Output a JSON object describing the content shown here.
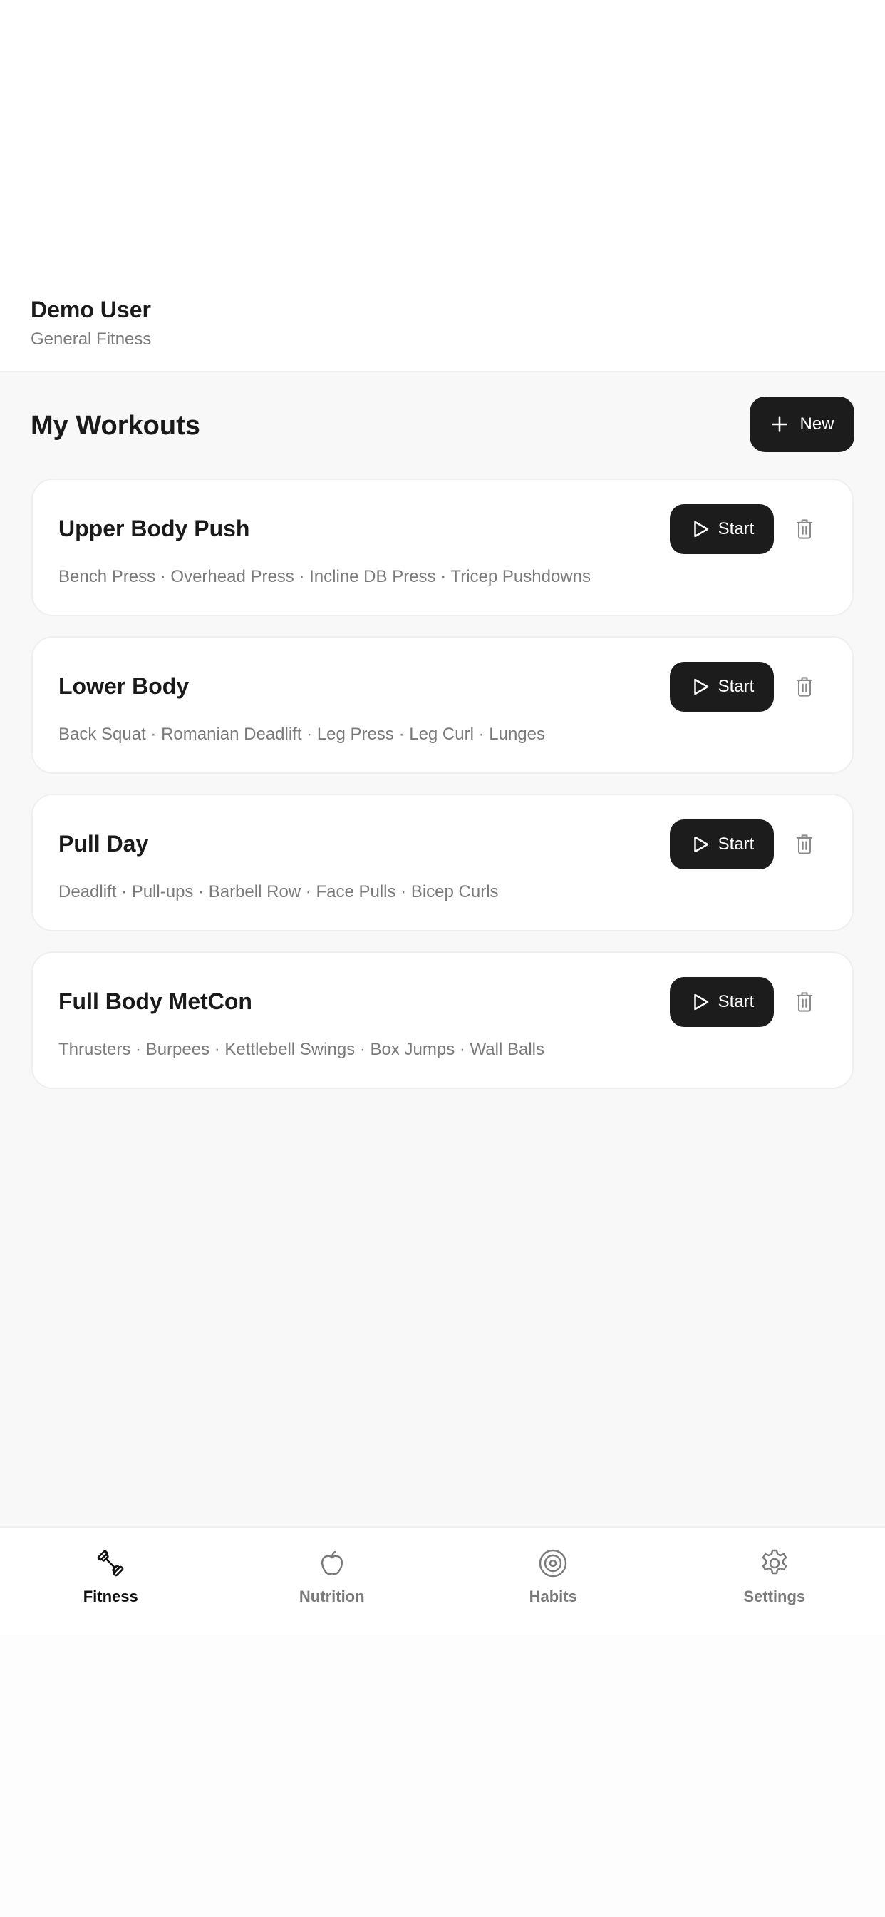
{
  "user": {
    "name": "Demo User",
    "subtitle": "General Fitness"
  },
  "workouts_section": {
    "title": "My Workouts",
    "new_label": "New"
  },
  "workouts": [
    {
      "name": "Upper Body Push",
      "exercises": "Bench Press · Overhead Press · Incline DB Press · Tricep Pushdowns",
      "start_label": "Start"
    },
    {
      "name": "Lower Body",
      "exercises": "Back Squat · Romanian Deadlift · Leg Press · Leg Curl · Lunges",
      "start_label": "Start"
    },
    {
      "name": "Pull Day",
      "exercises": "Deadlift · Pull-ups · Barbell Row · Face Pulls · Bicep Curls",
      "start_label": "Start"
    },
    {
      "name": "Full Body MetCon",
      "exercises": "Thrusters · Burpees · Kettlebell Swings · Box Jumps · Wall Balls",
      "start_label": "Start"
    }
  ],
  "nav": {
    "items": [
      {
        "label": "Fitness",
        "icon": "dumbbell-icon",
        "active": true
      },
      {
        "label": "Nutrition",
        "icon": "apple-icon",
        "active": false
      },
      {
        "label": "Habits",
        "icon": "target-icon",
        "active": false
      },
      {
        "label": "Settings",
        "icon": "gear-icon",
        "active": false
      }
    ]
  },
  "colors": {
    "primary_button": "#1c1c1c",
    "background": "#f8f8f8",
    "card": "#ffffff",
    "muted_text": "#7a7a7a"
  }
}
